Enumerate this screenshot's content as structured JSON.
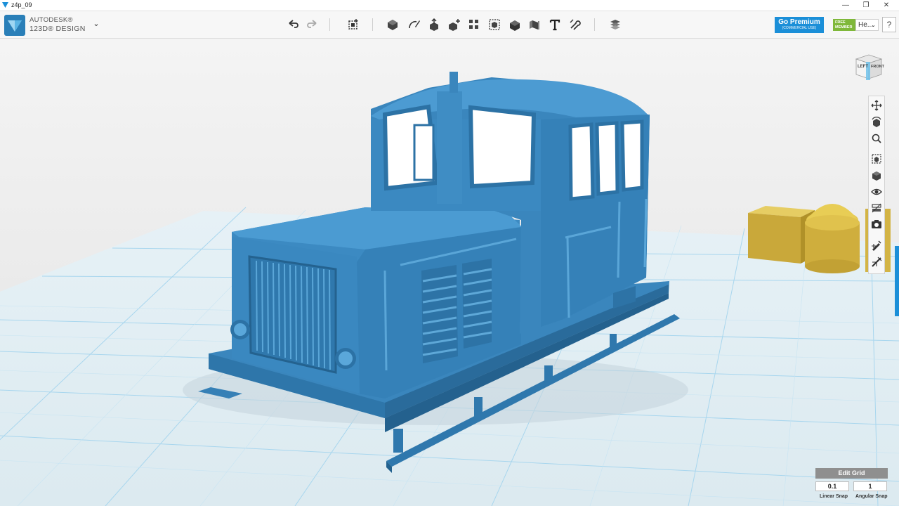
{
  "window": {
    "title": "z4p_09",
    "controls": [
      "—",
      "❐",
      "✕"
    ]
  },
  "brand": {
    "line1": "AUTODESK®",
    "line2": "123D® DESIGN"
  },
  "toolbar": {
    "main_menu_glyph": "⌄",
    "icons": [
      "undo-icon",
      "redo-icon",
      "transform-icon",
      "primitives-icon",
      "sketch-icon",
      "construct-icon",
      "modify-icon",
      "pattern-icon",
      "grouping-icon",
      "combine-icon",
      "measure-icon",
      "text-icon",
      "snap-icon",
      "material-icon"
    ],
    "go_premium": "Go Premium",
    "go_premium_sub": "(COMMERCIAL USE)",
    "free_badge_1": "FREE",
    "free_badge_2": "MEMBER",
    "user_label": "He...",
    "help": "?"
  },
  "viewcube": {
    "left": "LEFT",
    "front": "FRONT"
  },
  "navbar_icons": [
    "pan-icon",
    "orbit-icon",
    "zoom-icon",
    "fit-icon",
    "view-mode-icon",
    "visibility-icon",
    "material-view-icon",
    "screenshot-icon",
    "edit-grid-icon",
    "ruler-icon"
  ],
  "grid_panel": {
    "edit_grid": "Edit Grid",
    "linear_snap_value": "0.1",
    "angular_snap_value": "1",
    "linear_snap_label": "Linear Snap",
    "angular_snap_label": "Angular Snap"
  },
  "colors": {
    "accent": "#1b8fd8",
    "model": "#3a86bd",
    "grid_line": "#9fd3ee",
    "yellow": "#d9b93f"
  }
}
